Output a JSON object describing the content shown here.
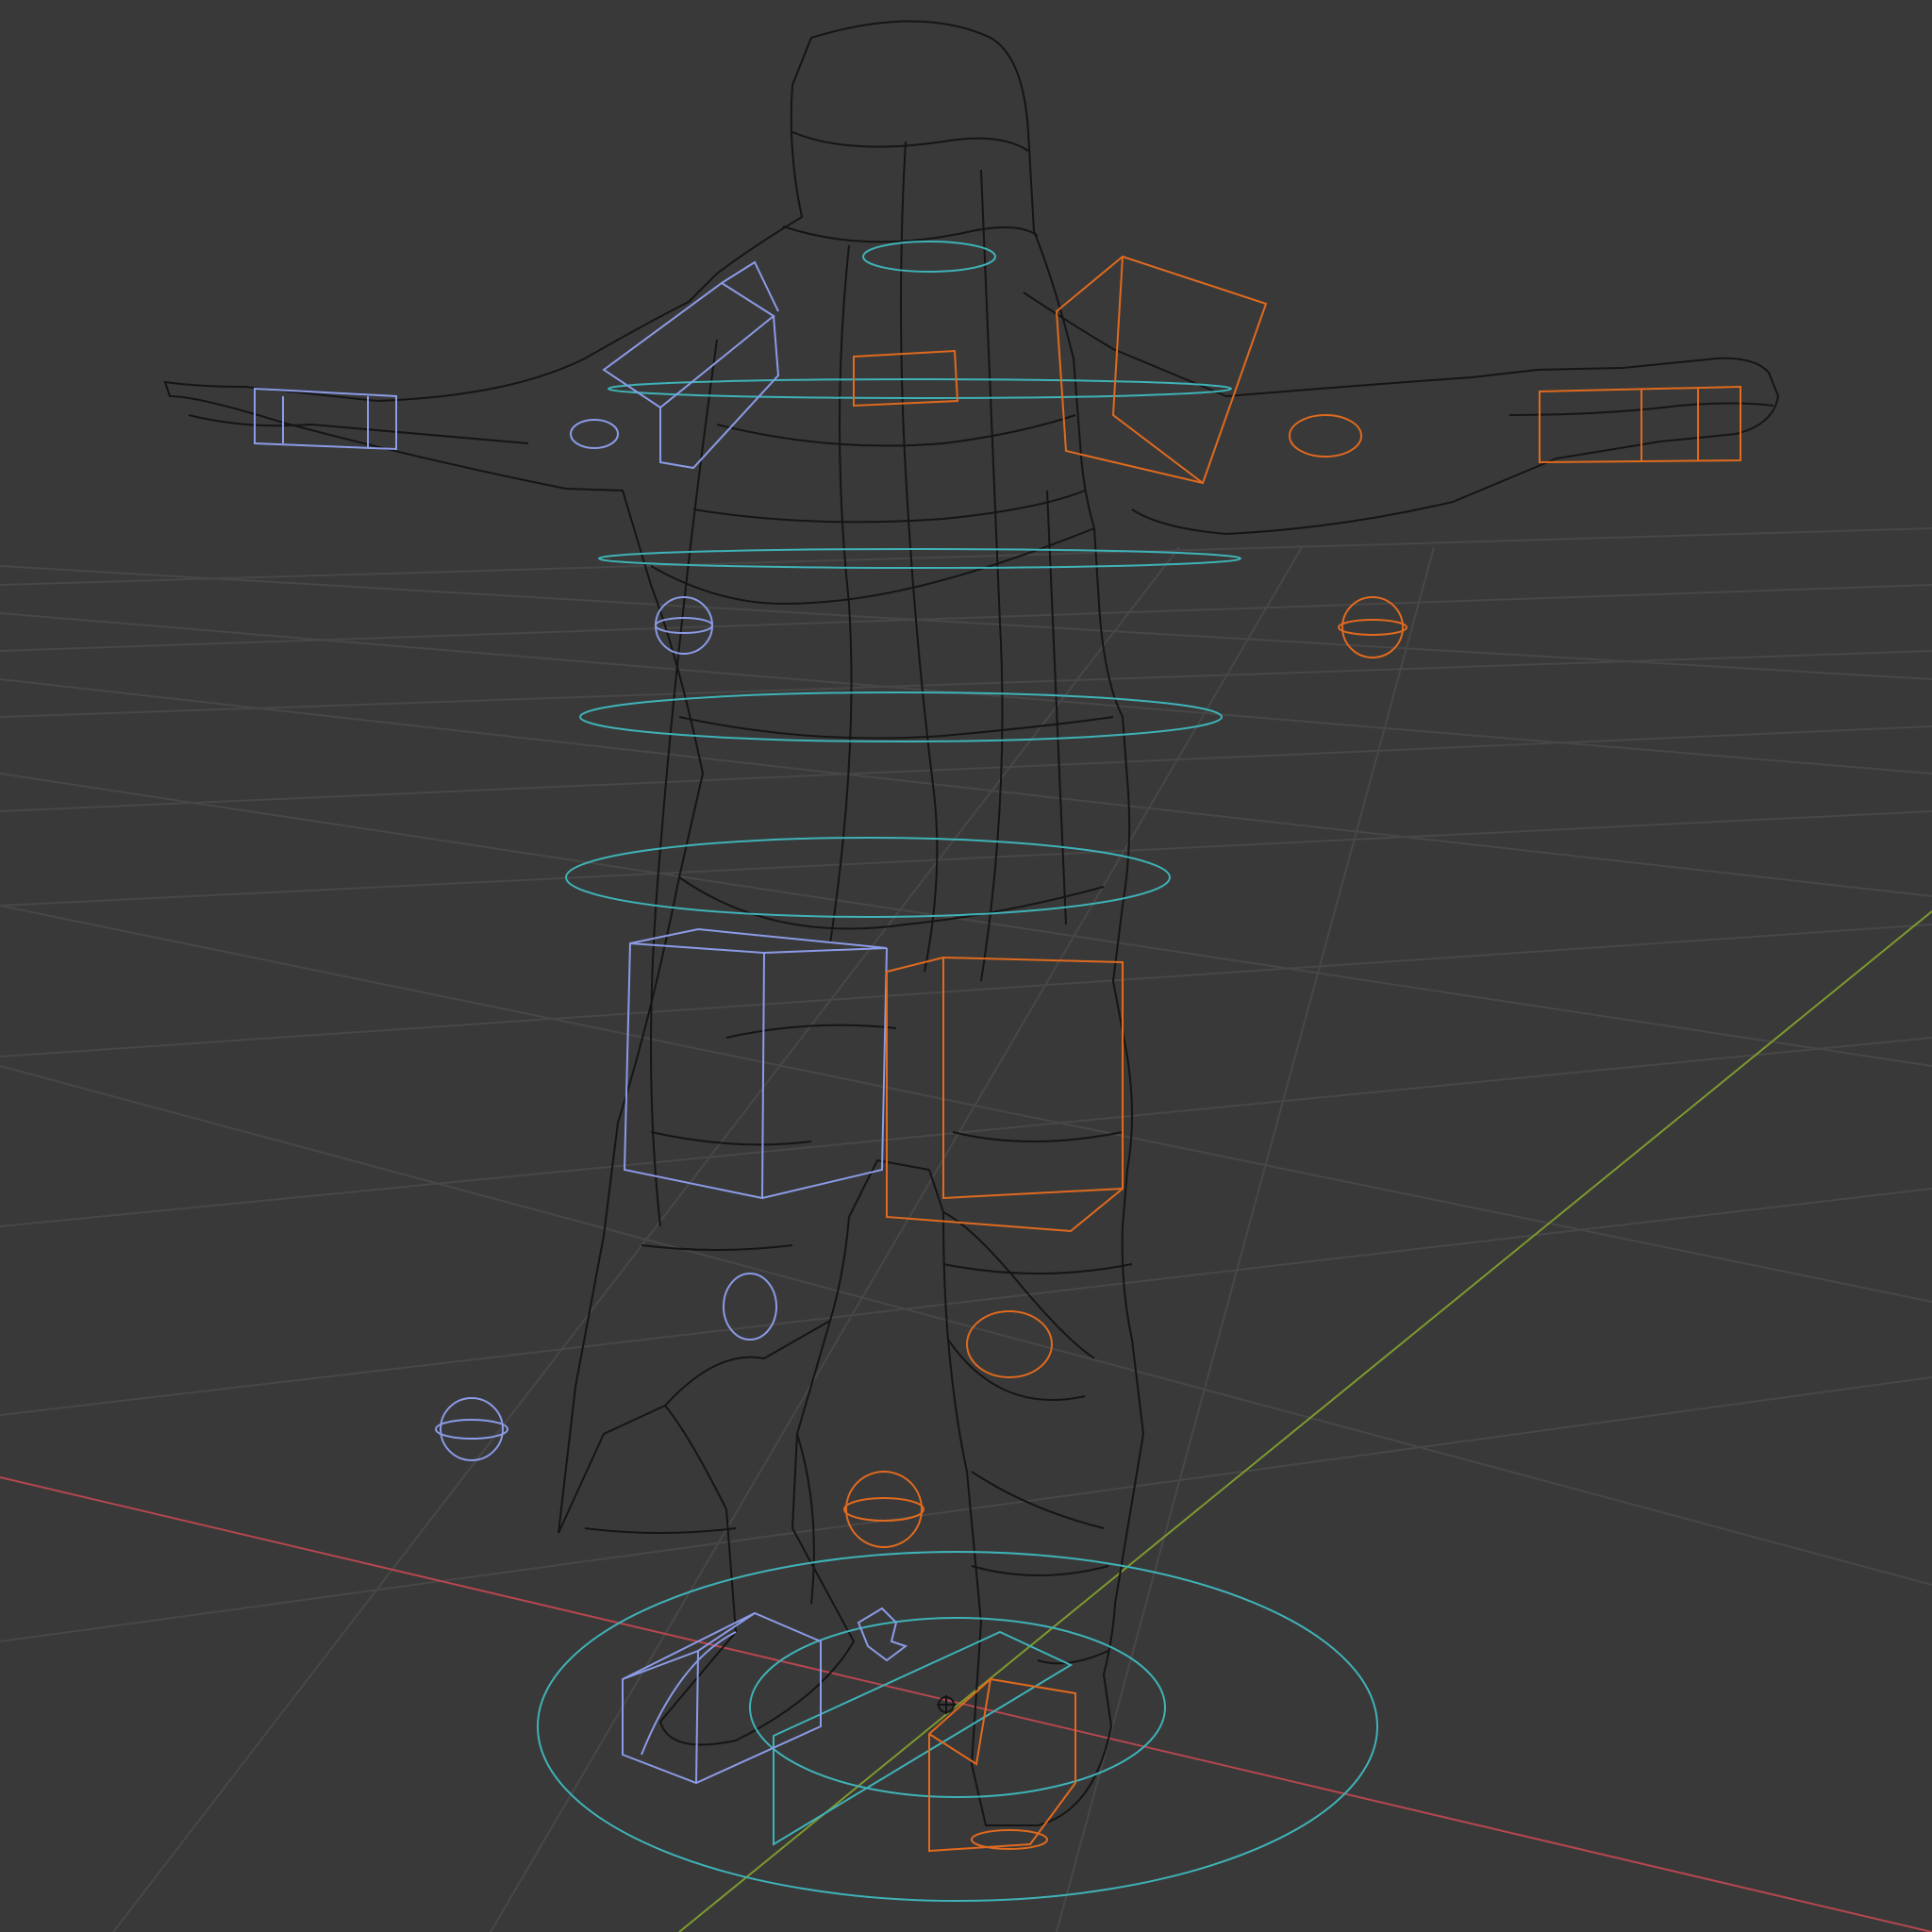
{
  "viewport": {
    "editor": "3D Viewport",
    "shading_mode": "wireframe",
    "background_color": "#393939",
    "grid_color": "#4a4a4a",
    "x_axis_color": "#b5474f",
    "y_axis_color": "#7d9a2e",
    "mesh_wire_color": "#151515",
    "left_controls_color": "#8b9be6",
    "right_controls_color": "#e06a1f",
    "center_controls_color": "#3fb3b8"
  },
  "scene": {
    "mesh": "character-mesh",
    "armature_controls": [
      "root-control",
      "torso-control",
      "chest-control",
      "spine-control",
      "hips-control",
      "neck-control",
      "shoulder-control-left",
      "shoulder-control-right",
      "hand-control-left",
      "hand-control-right",
      "elbow-pole-left",
      "elbow-pole-right",
      "thigh-control-left",
      "thigh-control-right",
      "knee-pole-left",
      "knee-pole-right",
      "foot-control-left",
      "foot-control-right"
    ]
  }
}
